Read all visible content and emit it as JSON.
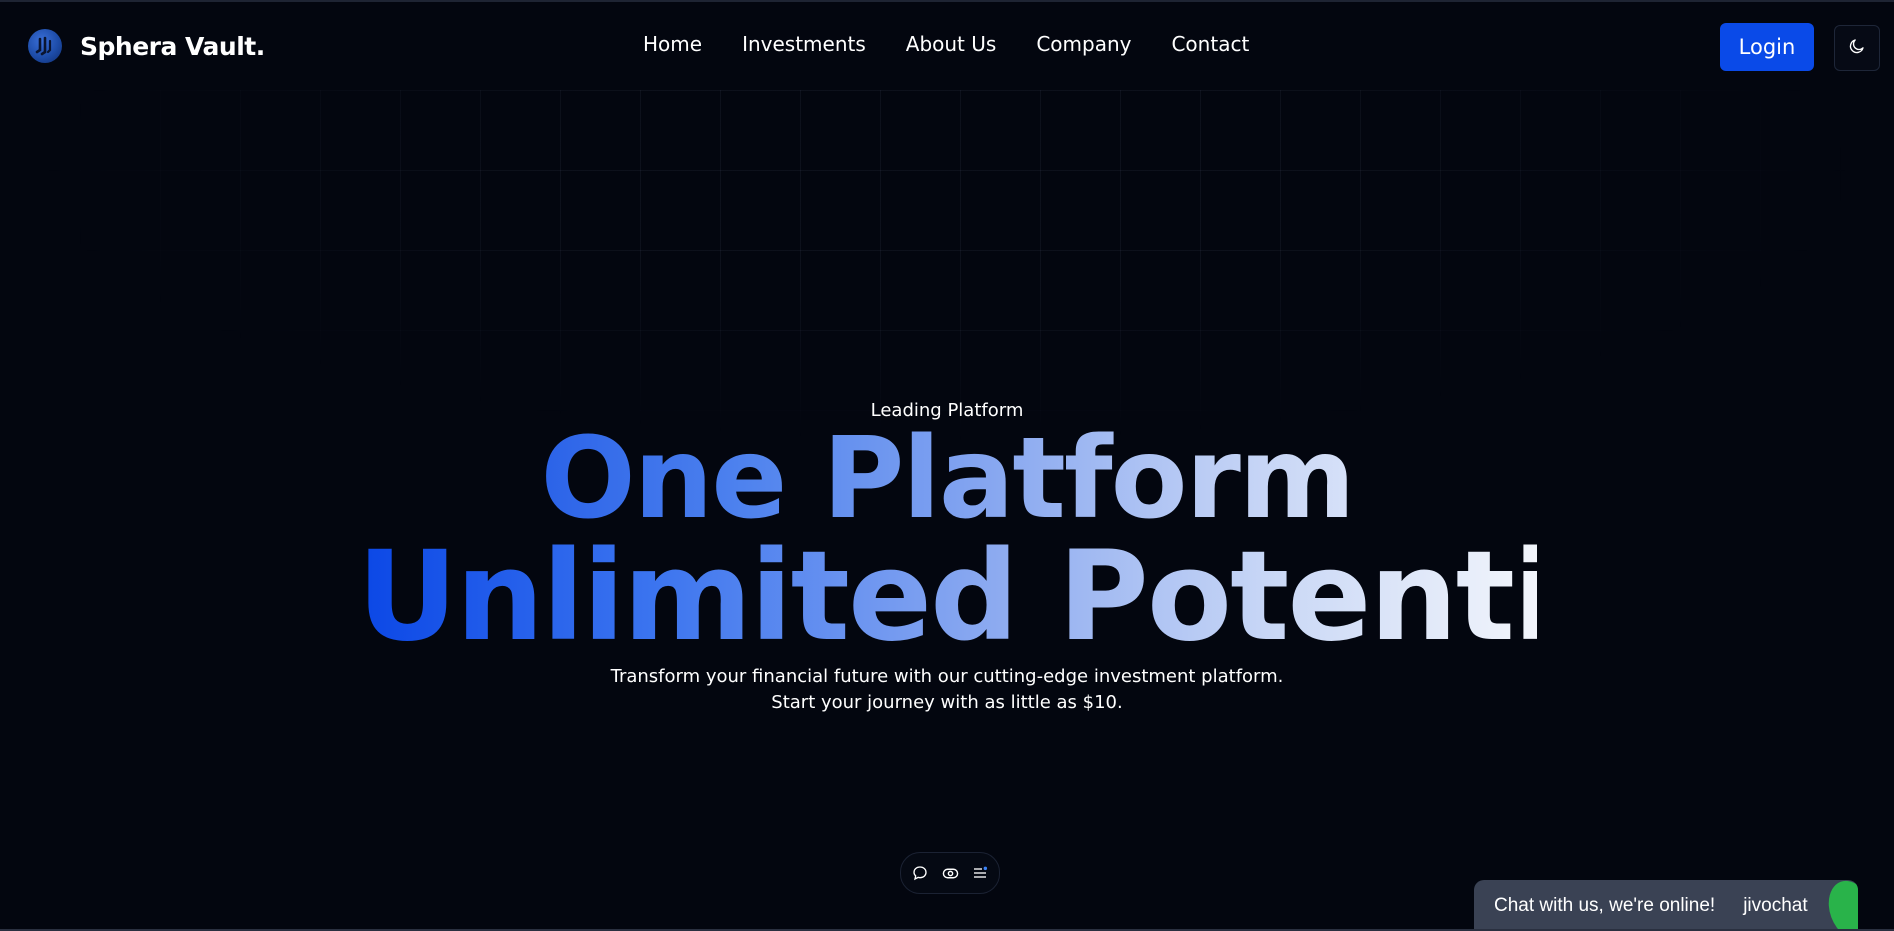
{
  "header": {
    "brand_name": "Sphera Vault.",
    "logo_icon": "sphera-logo-icon",
    "nav": [
      {
        "label": "Home"
      },
      {
        "label": "Investments"
      },
      {
        "label": "About Us"
      },
      {
        "label": "Company"
      },
      {
        "label": "Contact"
      }
    ],
    "login_label": "Login",
    "theme_toggle_icon": "moon-icon"
  },
  "hero": {
    "eyebrow": "Leading Platform",
    "title_line1": "One Platform",
    "title_line2": "Unlimited Potential",
    "subtitle_line1": "Transform your financial future with our cutting-edge investment platform.",
    "subtitle_line2": "Start your journey with as little as $10."
  },
  "floating_toolbar": {
    "icons": [
      "chat-bubble-icon",
      "eye-icon",
      "menu-list-icon"
    ]
  },
  "chat_widget": {
    "text": "Chat with us, we're online!",
    "brand": "jivochat"
  },
  "colors": {
    "background": "#03060f",
    "accent": "#0a4ae8",
    "chat_bg": "#3a4254",
    "chat_green": "#29b34a"
  }
}
